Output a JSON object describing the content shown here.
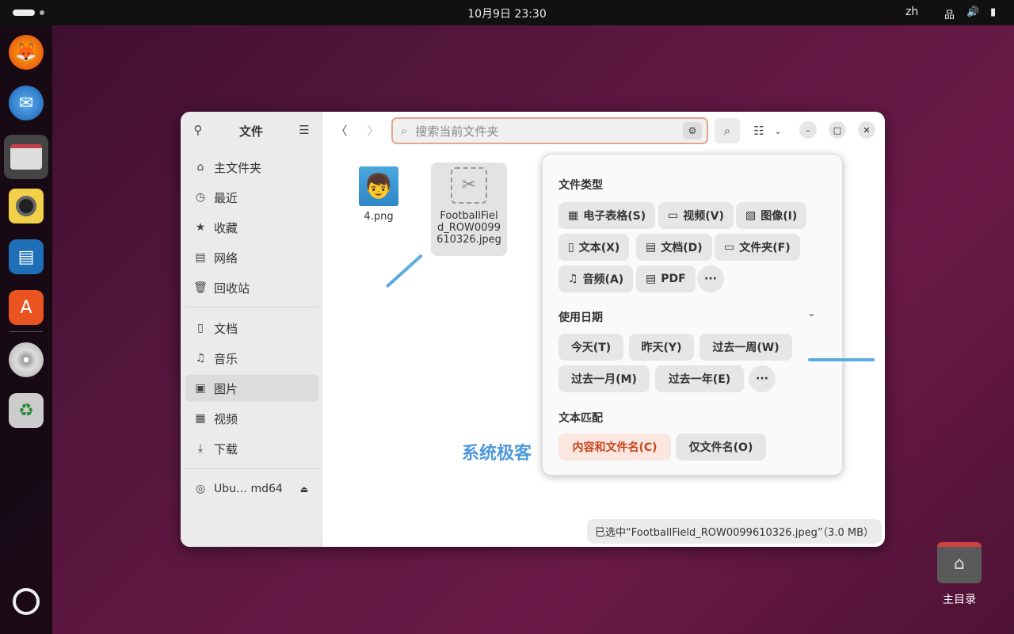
{
  "topbar": {
    "clock": "10月9日  23:30",
    "lang": "zh"
  },
  "dock": [
    "firefox",
    "thunderbird",
    "files",
    "rhythmbox",
    "libreoffice-writer",
    "app-center",
    "disc",
    "trash",
    "show-apps"
  ],
  "sidebar": {
    "title": "文件",
    "items": [
      {
        "label": "主文件夹",
        "icon": "⌂"
      },
      {
        "label": "最近",
        "icon": "◷"
      },
      {
        "label": "收藏",
        "icon": "★"
      },
      {
        "label": "网络",
        "icon": "▤"
      },
      {
        "label": "回收站",
        "icon": "🗑"
      },
      {
        "label": "文档",
        "icon": "▯"
      },
      {
        "label": "音乐",
        "icon": "♫"
      },
      {
        "label": "图片",
        "icon": "▣"
      },
      {
        "label": "视频",
        "icon": "▦"
      },
      {
        "label": "下载",
        "icon": "⤓"
      }
    ],
    "device": "Ubu… md64"
  },
  "search": {
    "placeholder": "搜索当前文件夹"
  },
  "files": [
    {
      "name": "4.png"
    },
    {
      "name": "FootballField_ROW0099610326.jpeg",
      "display": [
        "FootballFiel",
        "d_ROW0099",
        "610326.jpeg"
      ]
    }
  ],
  "status": "已选中“FootballField_ROW0099610326.jpeg”（3.0 MB）",
  "popover": {
    "file_type": {
      "heading": "文件类型",
      "chips": [
        "电子表格(S)",
        "视频(V)",
        "图像(I)",
        "文本(X)",
        "文档(D)",
        "文件夹(F)",
        "音频(A)",
        "PDF"
      ],
      "more": "···"
    },
    "date": {
      "heading": "使用日期",
      "chips": [
        "今天(T)",
        "昨天(Y)",
        "过去一周(W)",
        "过去一月(M)",
        "过去一年(E)"
      ],
      "more": "···"
    },
    "text_match": {
      "heading": "文本匹配",
      "chips": [
        "内容和文件名(C)",
        "仅文件名(O)"
      ],
      "selected": 0
    }
  },
  "desktop": {
    "home_label": "主目录"
  },
  "watermark": "系统极客",
  "colors": {
    "accent": "#c7441d",
    "arrow": "#5aacdf"
  }
}
